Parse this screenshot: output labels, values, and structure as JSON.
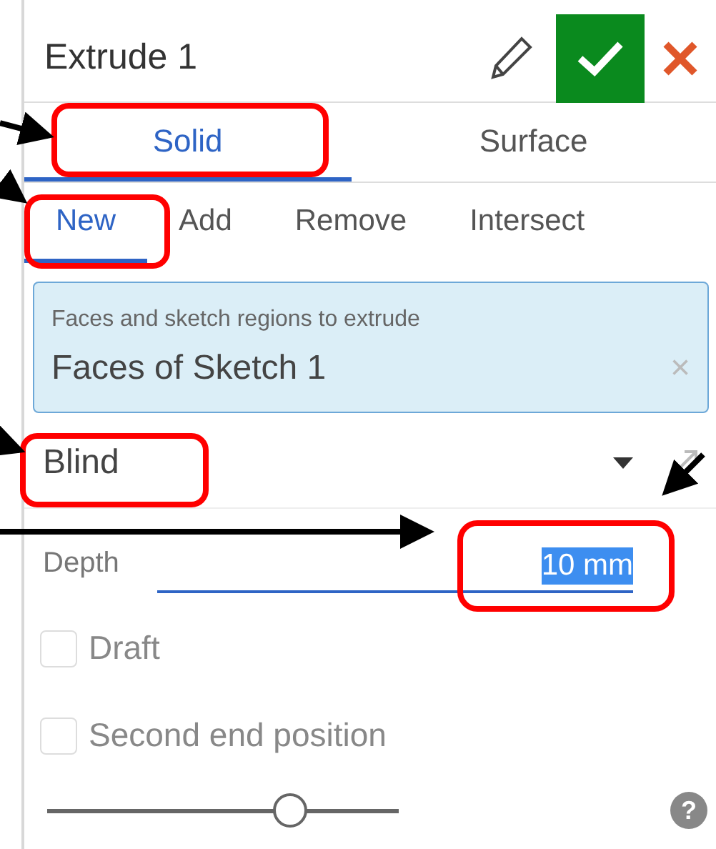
{
  "dialog": {
    "title": "Extrude 1"
  },
  "body_tabs": [
    {
      "label": "Solid",
      "selected": true
    },
    {
      "label": "Surface",
      "selected": false
    }
  ],
  "operation_tabs": [
    {
      "label": "New",
      "selected": true
    },
    {
      "label": "Add",
      "selected": false
    },
    {
      "label": "Remove",
      "selected": false
    },
    {
      "label": "Intersect",
      "selected": false
    }
  ],
  "selection_field": {
    "label": "Faces and sketch regions to extrude",
    "value": "Faces of Sketch 1",
    "clear": "×"
  },
  "end_type": {
    "value": "Blind"
  },
  "depth": {
    "label": "Depth",
    "value": "10 mm",
    "value_selected": true
  },
  "options": [
    {
      "label": "Draft",
      "checked": false
    },
    {
      "label": "Second end position",
      "checked": false
    }
  ],
  "slider": {
    "level": 0.69
  },
  "help": "?"
}
